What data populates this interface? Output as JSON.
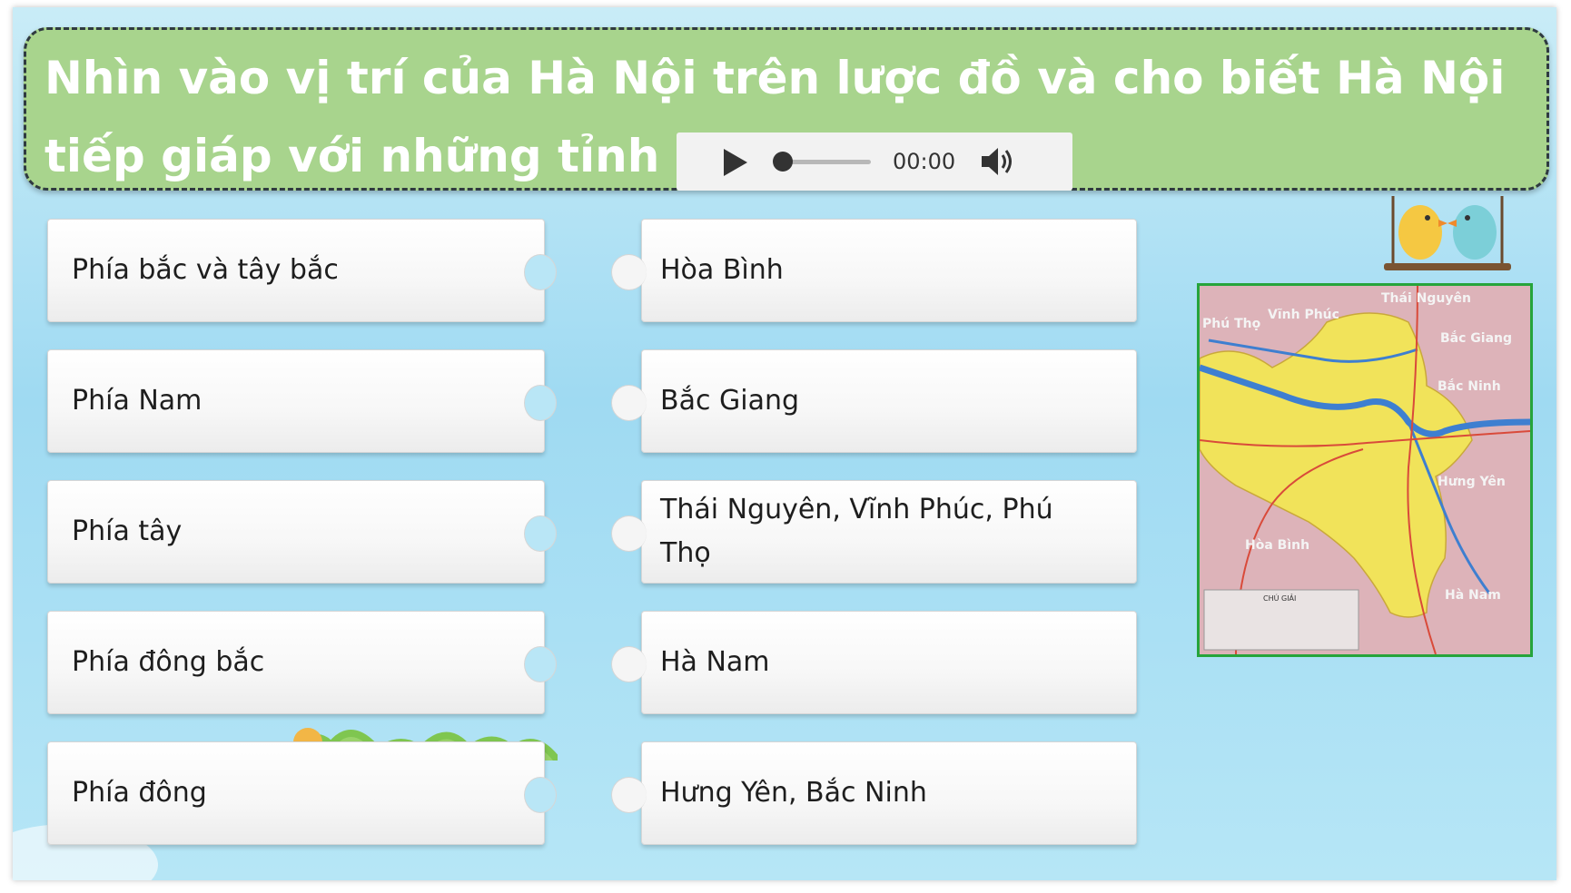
{
  "question": {
    "text": "Nhìn vào vị trí của Hà Nội trên lược đồ và cho biết Hà Nội tiếp giáp với những tỉnh nào ?"
  },
  "audio": {
    "time": "00:00",
    "progress": 0
  },
  "left_items": [
    {
      "label": "Phía bắc và tây bắc"
    },
    {
      "label": "Phía Nam"
    },
    {
      "label": "Phía tây"
    },
    {
      "label": "Phía đông bắc"
    },
    {
      "label": "Phía đông"
    }
  ],
  "right_items": [
    {
      "label": "Hòa Bình"
    },
    {
      "label": "Bắc Giang"
    },
    {
      "label": "Thái Nguyên, Vĩnh Phúc, Phú Thọ"
    },
    {
      "label": "Hà Nam"
    },
    {
      "label": "Hưng Yên, Bắc Ninh"
    }
  ],
  "map": {
    "labels": {
      "thai_nguyen": "Thái Nguyên",
      "vinh_phuc": "Vĩnh Phúc",
      "phu_tho": "Phú Thọ",
      "bac_giang": "Bắc Giang",
      "bac_ninh": "Bắc Ninh",
      "hung_yen": "Hưng Yên",
      "hoa_binh": "Hòa Bình",
      "ha_nam": "Hà Nam",
      "legend_title": "CHÚ GIẢI"
    }
  },
  "colors": {
    "question_bg": "#a8d48d",
    "map_border": "#26a43b",
    "hanoi_fill": "#f1e35a"
  }
}
